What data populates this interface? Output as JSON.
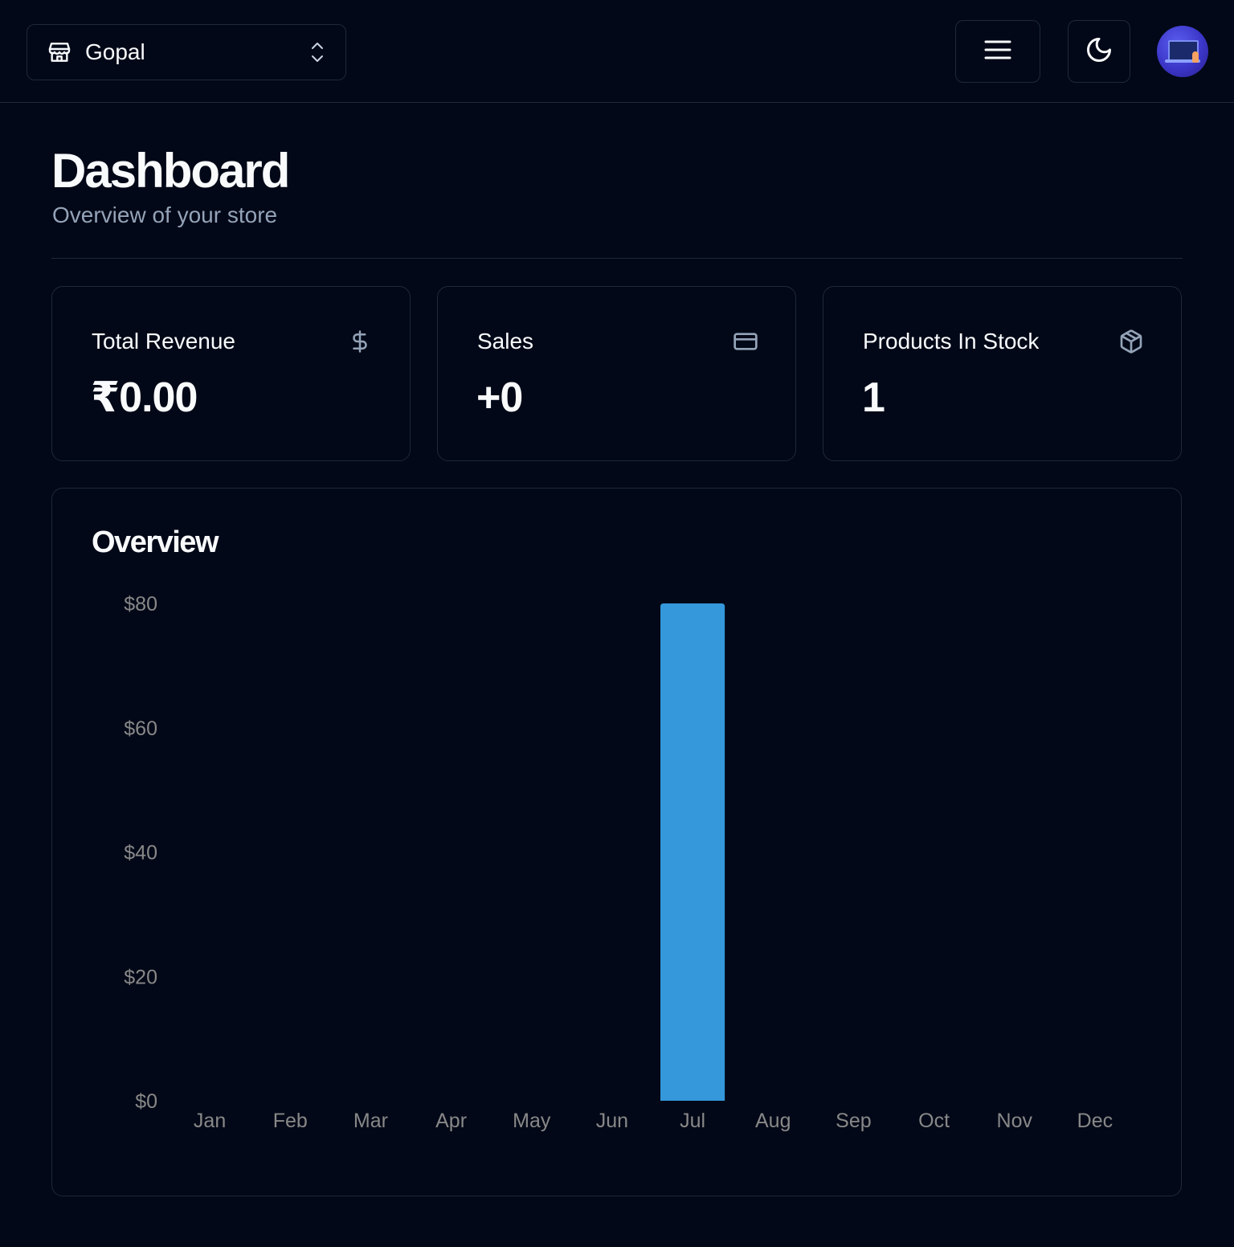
{
  "header": {
    "store_name": "Gopal",
    "icons": {
      "store": "store-icon",
      "switcher": "chevrons-up-down-icon",
      "menu": "menu-icon",
      "theme": "moon-icon",
      "avatar": "user-avatar"
    }
  },
  "page": {
    "title": "Dashboard",
    "subtitle": "Overview of your store"
  },
  "cards": [
    {
      "title": "Total Revenue",
      "value": "₹0.00",
      "icon": "dollar-sign-icon"
    },
    {
      "title": "Sales",
      "value": "+0",
      "icon": "credit-card-icon"
    },
    {
      "title": "Products In Stock",
      "value": "1",
      "icon": "package-icon"
    }
  ],
  "overview": {
    "title": "Overview"
  },
  "colors": {
    "background": "#020817",
    "border": "#1e293b",
    "muted_text": "#94a3b8",
    "axis_text": "#888888",
    "bar": "#3498db"
  },
  "chart_data": {
    "type": "bar",
    "categories": [
      "Jan",
      "Feb",
      "Mar",
      "Apr",
      "May",
      "Jun",
      "Jul",
      "Aug",
      "Sep",
      "Oct",
      "Nov",
      "Dec"
    ],
    "values": [
      0,
      0,
      0,
      0,
      0,
      0,
      80,
      0,
      0,
      0,
      0,
      0
    ],
    "ylim": [
      0,
      80
    ],
    "yticks": [
      0,
      20,
      40,
      60,
      80
    ],
    "ytick_labels": [
      "$0",
      "$20",
      "$40",
      "$60",
      "$80"
    ],
    "grid": false,
    "legend": "none"
  }
}
